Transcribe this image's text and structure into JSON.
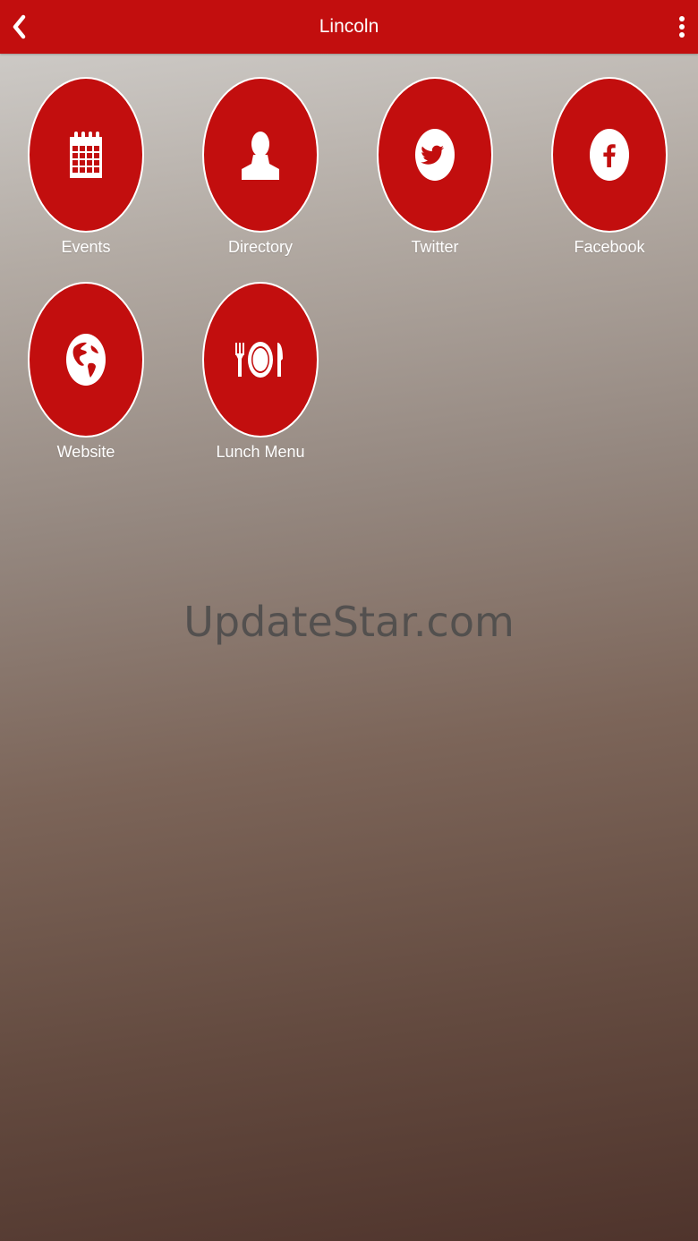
{
  "header": {
    "title": "Lincoln",
    "back_icon": "chevron-left-icon",
    "menu_icon": "more-vertical-icon"
  },
  "colors": {
    "accent": "#c20e0e",
    "text_light": "#ffffff"
  },
  "tiles": [
    {
      "label": "Events",
      "icon": "calendar-icon"
    },
    {
      "label": "Directory",
      "icon": "person-icon"
    },
    {
      "label": "Twitter",
      "icon": "twitter-icon"
    },
    {
      "label": "Facebook",
      "icon": "facebook-icon"
    },
    {
      "label": "Website",
      "icon": "globe-icon"
    },
    {
      "label": "Lunch Menu",
      "icon": "plate-cutlery-icon"
    }
  ],
  "watermark": "UpdateStar.com"
}
